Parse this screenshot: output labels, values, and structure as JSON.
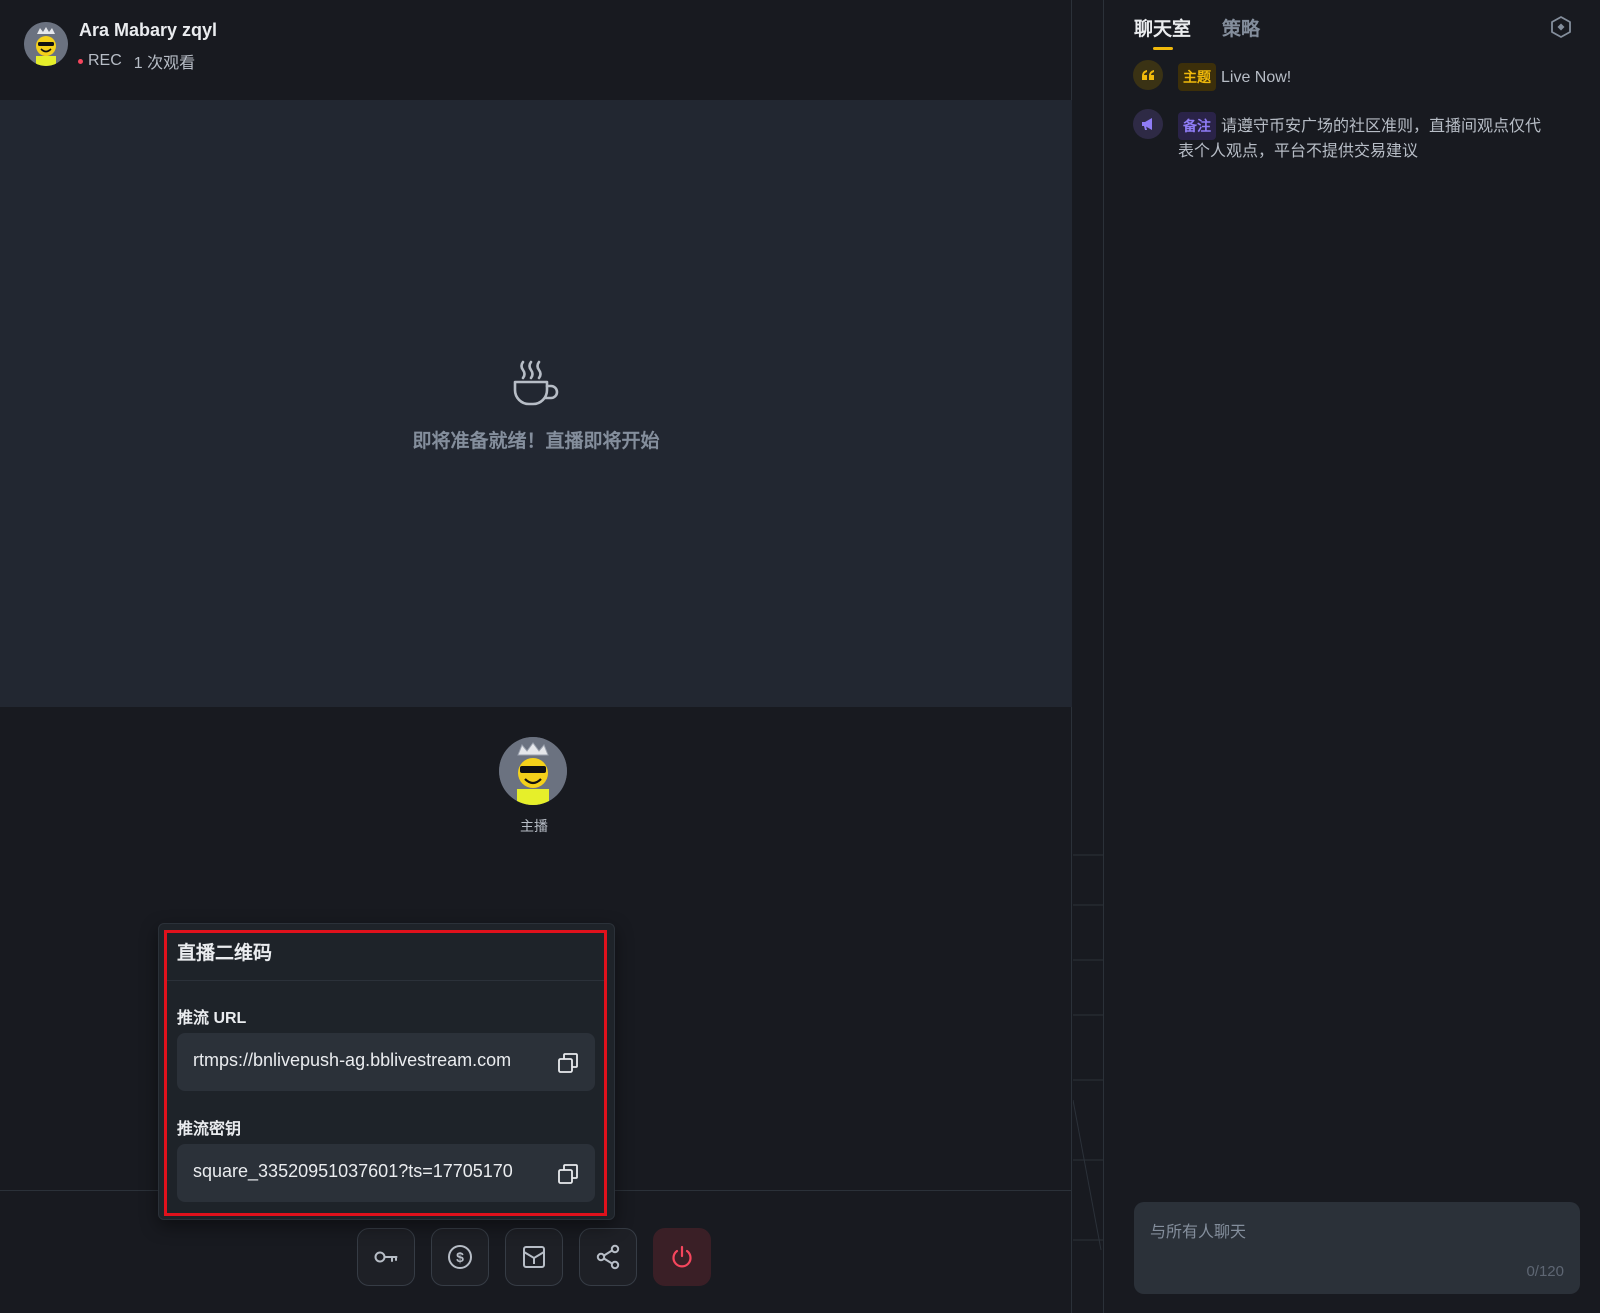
{
  "header": {
    "streamer_name": "Ara Mabary zqyl",
    "rec_label": "REC",
    "viewers": "1 次观看"
  },
  "video": {
    "ready_message": "即将准备就绪！直播即将开始",
    "icon": "coffee-cup-icon"
  },
  "host": {
    "label": "主播"
  },
  "popover": {
    "title": "直播二维码",
    "url_label": "推流 URL",
    "url_value": "rtmps://bnlivepush-ag.bblivestream.com",
    "key_label": "推流密钥",
    "key_value": "square_33520951037601?ts=17705170"
  },
  "toolbar": {
    "buttons": [
      "key-icon",
      "dollar-icon",
      "save-box-icon",
      "share-icon",
      "power-icon"
    ]
  },
  "chat": {
    "tabs": [
      "聊天室",
      "策略"
    ],
    "messages": [
      {
        "icon": "quote-icon",
        "badge": "主题",
        "text": "Live Now!"
      },
      {
        "icon": "megaphone-icon",
        "badge": "备注",
        "text_line1": "请遵守币安广场的社区准则，直播间观点仅代",
        "text_line2": "表个人观点，平台不提供交易建议"
      }
    ],
    "input_placeholder": "与所有人聊天",
    "char_count": "0/120"
  },
  "colors": {
    "accent": "#f0b90b",
    "danger": "#f6465d",
    "highlight_box": "#e0111c",
    "background": "#181a20",
    "video_bg": "#222731"
  }
}
